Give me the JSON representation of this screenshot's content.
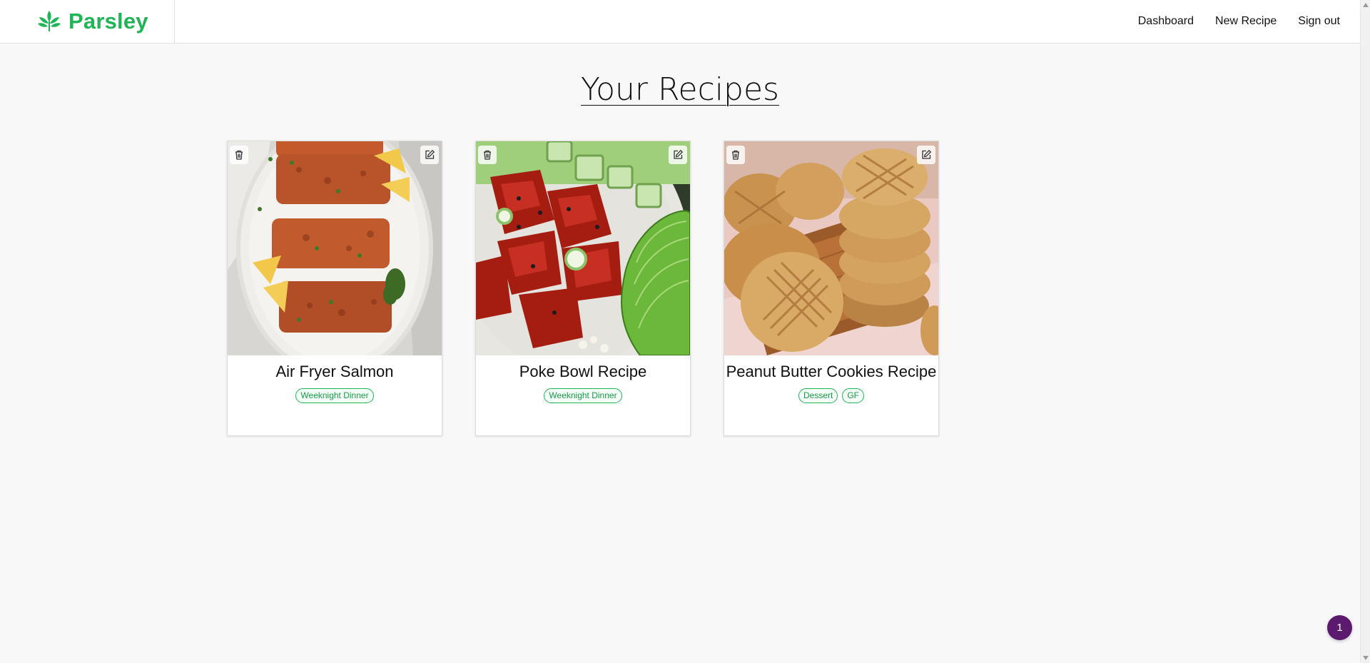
{
  "brand": {
    "name": "Parsley",
    "color": "#1fb557"
  },
  "nav": {
    "dashboard": "Dashboard",
    "new_recipe": "New Recipe",
    "sign_out": "Sign out"
  },
  "page": {
    "title": "Your Recipes"
  },
  "recipes": [
    {
      "title": "Air Fryer Salmon",
      "image": "salmon-fillets-photo",
      "tags": [
        "Weeknight Dinner"
      ]
    },
    {
      "title": "Poke Bowl Recipe",
      "image": "poke-bowl-photo",
      "tags": [
        "Weeknight Dinner"
      ]
    },
    {
      "title": "Peanut Butter Cookies Recipe",
      "image": "peanut-butter-cookies-photo",
      "tags": [
        "Dessert",
        "GF"
      ]
    }
  ],
  "icons": {
    "delete": "trash-icon",
    "edit": "edit-icon",
    "logo": "parsley-leaf-icon"
  },
  "notification_badge": {
    "count": "1",
    "color": "#5b1a6e"
  }
}
